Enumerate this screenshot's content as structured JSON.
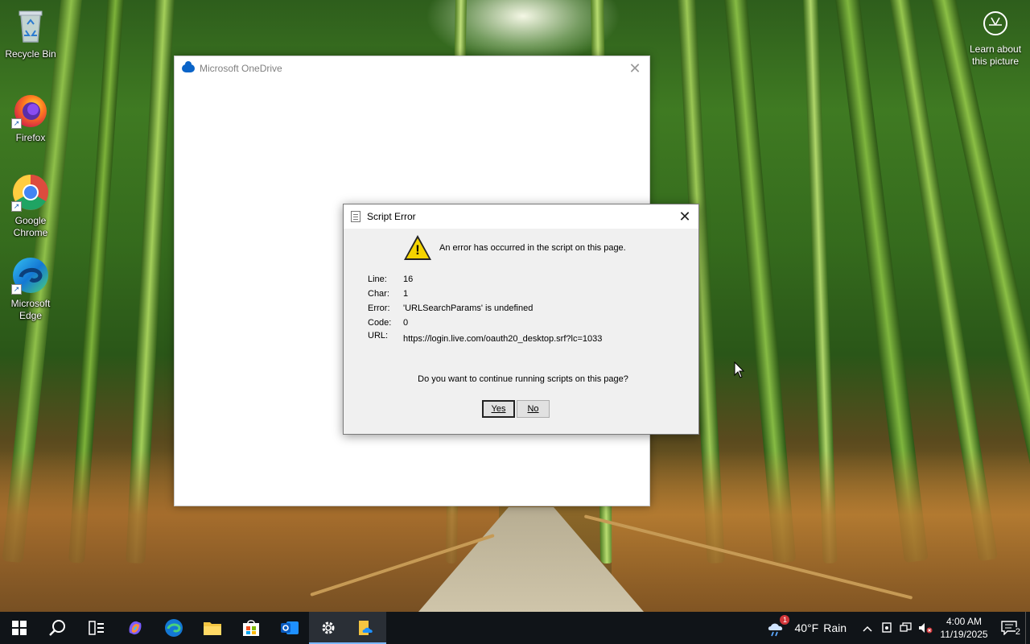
{
  "desktop": {
    "icons": [
      {
        "label": "Recycle Bin"
      },
      {
        "label": "Firefox"
      },
      {
        "label": "Google Chrome"
      },
      {
        "label": "Microsoft Edge"
      }
    ],
    "learn_label": "Learn about this picture"
  },
  "onedrive": {
    "title": "Microsoft OneDrive",
    "accent": "#0a64c8"
  },
  "dialog": {
    "title": "Script Error",
    "message": "An error has occurred in the script on this page.",
    "fields": [
      {
        "key": "Line:",
        "value": "16"
      },
      {
        "key": "Char:",
        "value": "1"
      },
      {
        "key": "Error:",
        "value": "'URLSearchParams' is undefined"
      },
      {
        "key": "Code:",
        "value": "0"
      },
      {
        "key": "URL:",
        "value": "https://login.live.com/oauth20_desktop.srf?lc=1033"
      }
    ],
    "question": "Do you want to continue running scripts on this page?",
    "yes_label": "Yes",
    "no_label": "No"
  },
  "taskbar": {
    "weather_temp": "40°F",
    "weather_text": "Rain",
    "weather_badge": "1",
    "time": "4:00 AM",
    "date": "11/19/2025",
    "notification_count": "2"
  }
}
